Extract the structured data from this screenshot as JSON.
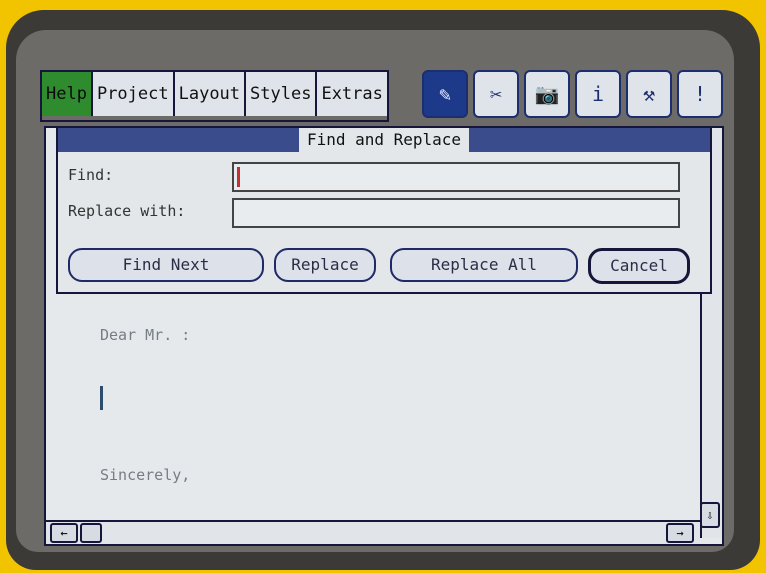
{
  "menu": {
    "items": [
      {
        "label": "Help"
      },
      {
        "label": "Project"
      },
      {
        "label": "Layout"
      },
      {
        "label": "Styles"
      },
      {
        "label": "Extras"
      }
    ]
  },
  "tools": [
    {
      "icon": "pencil-icon",
      "glyph": "✎"
    },
    {
      "icon": "scissors-icon",
      "glyph": "✂"
    },
    {
      "icon": "camera-icon",
      "glyph": "📷"
    },
    {
      "icon": "info-icon",
      "glyph": "i"
    },
    {
      "icon": "paint-roller-icon",
      "glyph": "⚒"
    },
    {
      "icon": "exclamation-icon",
      "glyph": "!"
    }
  ],
  "dialog": {
    "title": "Find and Replace",
    "find_label": "Find:",
    "find_value": "",
    "replace_label": "Replace with:",
    "replace_value": "",
    "buttons": {
      "find_next": "Find Next",
      "replace": "Replace",
      "replace_all": "Replace All",
      "cancel": "Cancel"
    }
  },
  "document": {
    "salutation": "Dear Mr. :",
    "closing": "Sincerely,"
  },
  "scroll": {
    "left_arrow": "←",
    "right_arrow": "→",
    "down_arrow": "⇩"
  },
  "colors": {
    "active_menu": "#2e8b2e",
    "title_bar": "#3a4c8c",
    "background": "#f2c400"
  }
}
